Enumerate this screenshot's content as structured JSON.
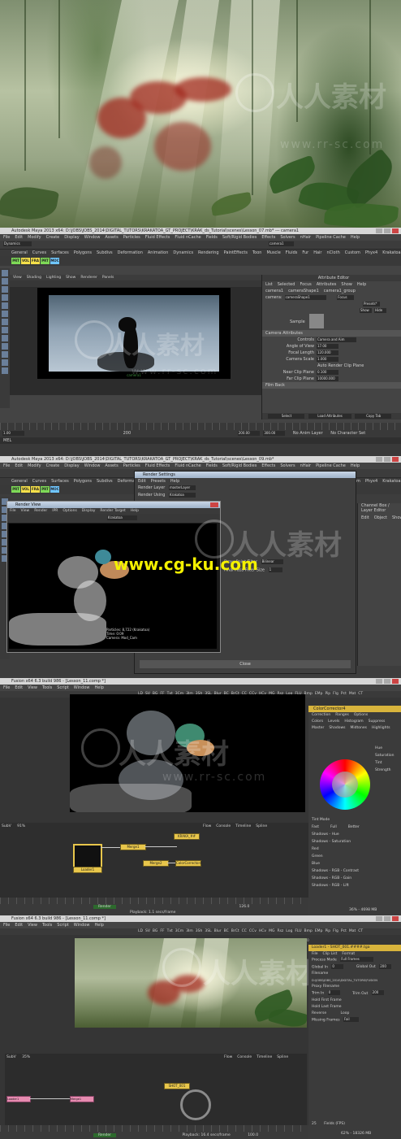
{
  "panel_maya1": {
    "title": "Autodesk Maya 2013 x64: D:\\JOBS\\JOBS_2014\\DIGITAL_TUTORS\\KRAKATOA_GT_PROJECT\\KRAK_ds_Tutorial\\scenes\\Lesson_07.mb* --- camera1",
    "menu": [
      "File",
      "Edit",
      "Modify",
      "Create",
      "Display",
      "Window",
      "Assets",
      "Particles",
      "Fluid Effects",
      "Fluid nCache",
      "Fields",
      "Soft/Rigid Bodies",
      "Effects",
      "Solvers",
      "nHair",
      "Pipeline Cache",
      "Help"
    ],
    "module": "Dynamics",
    "tabs": [
      "General",
      "Curves",
      "Surfaces",
      "Polygons",
      "Subdivs",
      "Deformation",
      "Animation",
      "Dynamics",
      "Rendering",
      "PaintEffects",
      "Toon",
      "Muscle",
      "Fluids",
      "Fur",
      "Hair",
      "nCloth",
      "Custom",
      "Phyx4",
      "Krakatoa"
    ],
    "shelf": [
      "PRT",
      "VOL",
      "FRA",
      "PRT",
      "MOC"
    ],
    "panel_menu": [
      "View",
      "Shading",
      "Lighting",
      "Show",
      "Renderer",
      "Panels"
    ],
    "resolution": "1920 x 1080",
    "camera_label": "camera1",
    "attr_menu": [
      "List",
      "Selected",
      "Focus",
      "Attributes",
      "Show",
      "Help"
    ],
    "attr_tabs": [
      "camera1",
      "cameraShape1",
      "camera1_group"
    ],
    "attr_header": "Attribute Editor",
    "attr_camera_field_label": "camera:",
    "attr_camera_value": "cameraShape1",
    "focus_btn": "Focus",
    "presets_btn": "Presets*",
    "show_btn": "Show",
    "hide_btn": "Hide",
    "sample_label": "Sample",
    "section_camera_attr": "Camera Attributes",
    "controls_label": "Controls",
    "controls_value": "Camera and Aim",
    "angle_label": "Angle of View",
    "angle_value": "17.00",
    "focal_label": "Focal Length",
    "focal_value": "120.000",
    "scale_label": "Camera Scale",
    "scale_value": "1.000",
    "auto_clip": "Auto Render Clip Plane",
    "near_label": "Near Clip Plane",
    "near_value": "0.100",
    "far_label": "Far Clip Plane",
    "far_value": "10000.000",
    "section_film": "Film Back",
    "btn_select": "Select",
    "btn_load": "Load Attributes",
    "btn_copy": "Copy Tab",
    "time_start": "1.00",
    "time_end": "200",
    "range_a": "200.00",
    "range_b": "300.00",
    "anim_layer": "No Anim Layer",
    "char_set": "No Character Set",
    "mel": "MEL"
  },
  "panel_maya2": {
    "title": "Autodesk Maya 2013 x64: D:\\JOBS\\JOBS_2014\\DIGITAL_TUTORS\\KRAKATOA_GT_PROJECT\\KRAK_ds_Tutorial\\scenes\\Lesson_09.mb*",
    "render_settings_title": "Render Settings",
    "render_layer_label": "Render Layer",
    "render_layer_value": "masterLayer",
    "render_using_label": "Render Using",
    "render_using_value": "Krakatoa",
    "render_view_title": "Render View",
    "rv_menu": [
      "File",
      "View",
      "Render",
      "IPR",
      "Options",
      "Display",
      "Render Target",
      "Help"
    ],
    "rv_display": "Krakatoa",
    "rv_stats": [
      "Particles: 8,722 (Krakatoa)",
      "Time: 0:09",
      "Camera: Mod_Cam"
    ],
    "draw_filter_label": "Draw Point Filter",
    "draw_filter_value": "Bilinear",
    "filter_size_label": "Final Pass Filter Size",
    "filter_size_value": "1",
    "close_btn": "Close",
    "url": "www.cg-ku.com",
    "attr_header": "Channel Box / Layer Editor",
    "edit_obj": [
      "Edit",
      "Object",
      "Show"
    ]
  },
  "panel_fusion1": {
    "title": "Fusion x64 6.3 build 986 - [Lesson_11.comp *]",
    "menu": [
      "File",
      "Edit",
      "View",
      "Tools",
      "Script",
      "Window",
      "Help"
    ],
    "top_tools": [
      "LD",
      "SV",
      "BG",
      "FF",
      "Txt",
      "3Cm",
      "3Im",
      "3Sh",
      "3SL",
      "Blur",
      "BC",
      "BrCt",
      "CC",
      "CCv",
      "HCv",
      "MG",
      "Rsz",
      "Log",
      "FLU",
      "Bmp",
      "EMp",
      "Pip",
      "Flg",
      "Pct",
      "Mat",
      "CT"
    ],
    "tool_name": "ColorCorrector4",
    "tool_tabs": [
      "Correction",
      "Ranges",
      "Options"
    ],
    "sub_tabs": [
      "Colors",
      "Levels",
      "Histogram",
      "Suppress"
    ],
    "channel_tabs": [
      "Master",
      "Shadows",
      "Midtones",
      "Highlights"
    ],
    "hue_label": "Hue",
    "sat_label": "Saturation",
    "tint_label": "Tint",
    "strength_label": "Strength",
    "tint_mode_label": "Tint Mode",
    "tint_modes": [
      "Fast",
      "Full",
      "Better"
    ],
    "controls": [
      "Shadows - Hue",
      "Shadows - Saturation",
      "Red",
      "Green",
      "Blue",
      "Shadows - RGB - Contrast",
      "Shadows - RGB - Gain",
      "Shadows - RGB - Lift"
    ],
    "flow_tabs": [
      "Flow",
      "Console",
      "Timeline",
      "Spline"
    ],
    "nodes": [
      "Loader1",
      "KRAKA_##",
      "ColorCorrector4",
      "Merge1",
      "Merge2"
    ],
    "subv": "SubV",
    "zoom": "91%",
    "frame": "126.0",
    "render_btn": "Render",
    "playback": "Playback: 1.1 secs/frame",
    "status_a": "36% - 4698 MB"
  },
  "panel_fusion2": {
    "title": "Fusion x64 6.3 build 986 - [Lesson_11.comp *]",
    "menu": [
      "File",
      "Edit",
      "View",
      "Tools",
      "Script",
      "Window",
      "Help"
    ],
    "tool_name": "Loader1 - SHOT_001.####.tga",
    "process_mode_label": "Process Mode",
    "process_mode_value": "Full Frames",
    "global_in_label": "Global In",
    "global_in_value": "0",
    "global_out_label": "Global Out",
    "global_out_value": "200",
    "filename_label": "Filename",
    "filename_value": "D:\\JOBS\\JOBS_2014\\DIGITAL_TUTORS\\FUSION",
    "proxy_label": "Proxy Filename",
    "trim_in_label": "Trim In",
    "trim_in_value": "0",
    "trim_out_label": "Trim Out",
    "trim_out_value": "200",
    "hold_first": "Hold First Frame",
    "hold_last": "Hold Last Frame",
    "reverse": "Reverse",
    "loop": "Loop",
    "missing_label": "Missing Frames",
    "missing_value": "Fail",
    "format_tabs": [
      "File",
      "Clip List",
      "Format"
    ],
    "resolution": "1920x1080",
    "nodes": [
      "Loader1",
      "SHOT_001",
      "Merge1"
    ],
    "subv": "SubV",
    "zoom": "35%",
    "frame": "100.0",
    "fps_label": "Fields (FPS)",
    "fps_value": "25",
    "render_btn": "Render",
    "playback": "Playback: 16.4 secs/frame",
    "status_a": "62% - 18326 MB"
  },
  "watermark": {
    "cn": "人人素材",
    "url": "www.rr-sc.com"
  }
}
